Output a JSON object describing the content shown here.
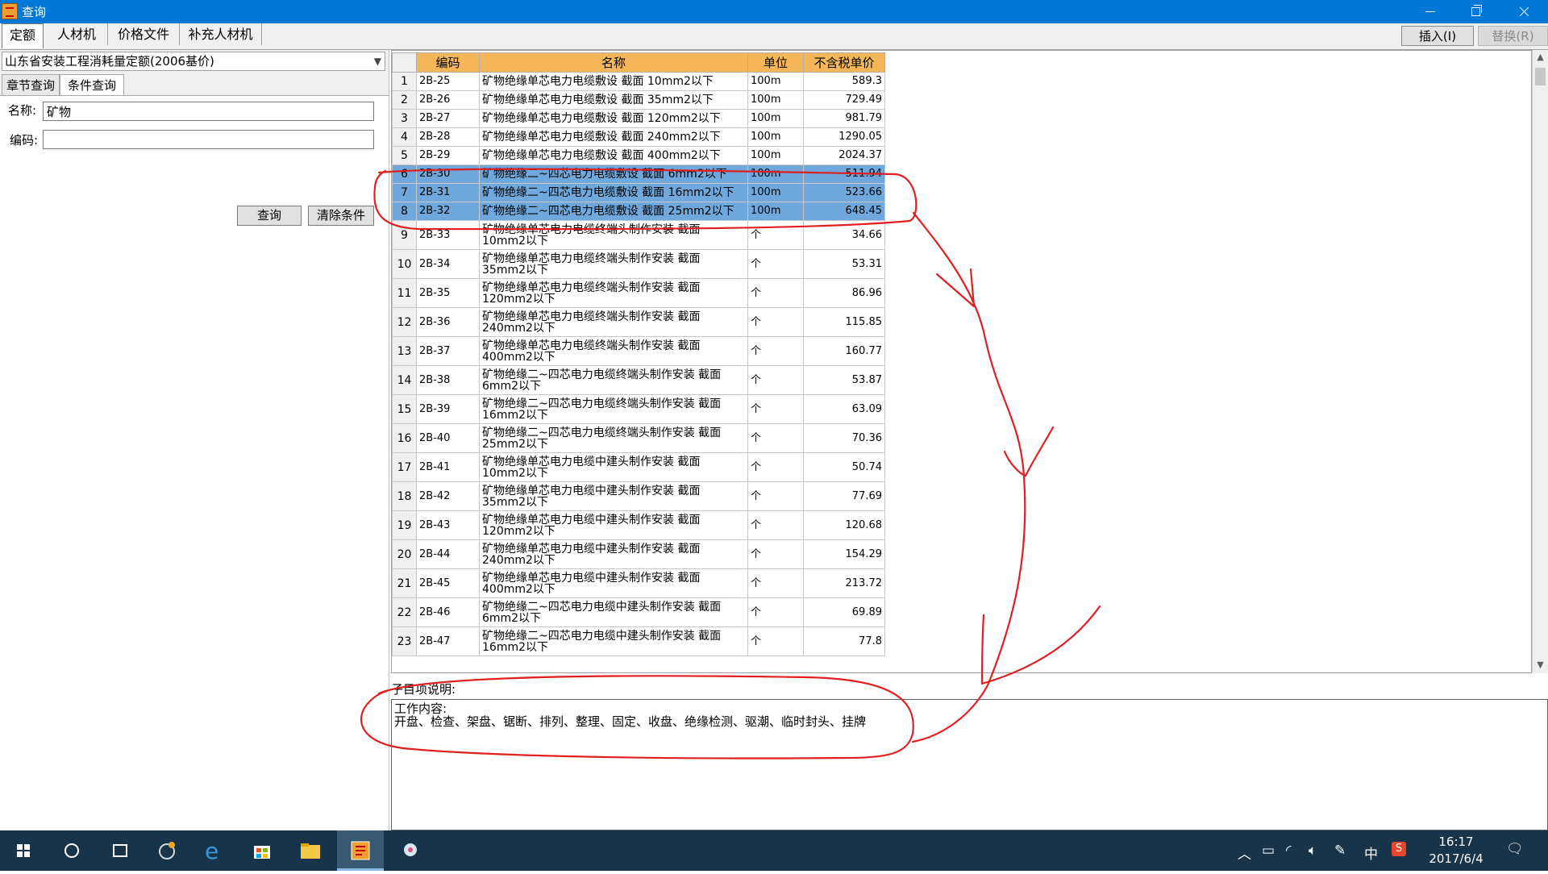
{
  "window": {
    "title": "查询"
  },
  "top_tabs": [
    "定额",
    "人材机",
    "价格文件",
    "补充人材机"
  ],
  "toolbar": {
    "insert_label": "插入(I)",
    "replace_label": "替换(R)"
  },
  "left": {
    "quota_library": "山东省安装工程消耗量定额(2006基价)",
    "sub_tabs": [
      "章节查询",
      "条件查询"
    ],
    "name_label": "名称:",
    "name_value": "矿物",
    "code_label": "编码:",
    "code_value": "",
    "query_button": "查询",
    "clear_button": "清除条件"
  },
  "table": {
    "headers": [
      "编码",
      "名称",
      "单位",
      "不含税单价"
    ],
    "rows": [
      {
        "n": "1",
        "code": "2B-25",
        "name": "矿物绝缘单芯电力电缆敷设 截面 10mm2以下",
        "unit": "100m",
        "price": "589.3"
      },
      {
        "n": "2",
        "code": "2B-26",
        "name": "矿物绝缘单芯电力电缆敷设 截面 35mm2以下",
        "unit": "100m",
        "price": "729.49"
      },
      {
        "n": "3",
        "code": "2B-27",
        "name": "矿物绝缘单芯电力电缆敷设 截面 120mm2以下",
        "unit": "100m",
        "price": "981.79"
      },
      {
        "n": "4",
        "code": "2B-28",
        "name": "矿物绝缘单芯电力电缆敷设 截面 240mm2以下",
        "unit": "100m",
        "price": "1290.05"
      },
      {
        "n": "5",
        "code": "2B-29",
        "name": "矿物绝缘单芯电力电缆敷设 截面 400mm2以下",
        "unit": "100m",
        "price": "2024.37"
      },
      {
        "n": "6",
        "code": "2B-30",
        "name": "矿物绝缘二~四芯电力电缆敷设 截面 6mm2以下",
        "unit": "100m",
        "price": "511.94"
      },
      {
        "n": "7",
        "code": "2B-31",
        "name": "矿物绝缘二~四芯电力电缆敷设 截面 16mm2以下",
        "unit": "100m",
        "price": "523.66"
      },
      {
        "n": "8",
        "code": "2B-32",
        "name": "矿物绝缘二~四芯电力电缆敷设 截面 25mm2以下",
        "unit": "100m",
        "price": "648.45"
      },
      {
        "n": "9",
        "code": "2B-33",
        "name": "矿物绝缘单芯电力电缆终端头制作安装 截面 10mm2以下",
        "unit": "个",
        "price": "34.66"
      },
      {
        "n": "10",
        "code": "2B-34",
        "name": "矿物绝缘单芯电力电缆终端头制作安装 截面 35mm2以下",
        "unit": "个",
        "price": "53.31"
      },
      {
        "n": "11",
        "code": "2B-35",
        "name": "矿物绝缘单芯电力电缆终端头制作安装 截面 120mm2以下",
        "unit": "个",
        "price": "86.96"
      },
      {
        "n": "12",
        "code": "2B-36",
        "name": "矿物绝缘单芯电力电缆终端头制作安装 截面 240mm2以下",
        "unit": "个",
        "price": "115.85"
      },
      {
        "n": "13",
        "code": "2B-37",
        "name": "矿物绝缘单芯电力电缆终端头制作安装 截面 400mm2以下",
        "unit": "个",
        "price": "160.77"
      },
      {
        "n": "14",
        "code": "2B-38",
        "name": "矿物绝缘二~四芯电力电缆终端头制作安装 截面 6mm2以下",
        "unit": "个",
        "price": "53.87"
      },
      {
        "n": "15",
        "code": "2B-39",
        "name": "矿物绝缘二~四芯电力电缆终端头制作安装 截面 16mm2以下",
        "unit": "个",
        "price": "63.09"
      },
      {
        "n": "16",
        "code": "2B-40",
        "name": "矿物绝缘二~四芯电力电缆终端头制作安装 截面 25mm2以下",
        "unit": "个",
        "price": "70.36"
      },
      {
        "n": "17",
        "code": "2B-41",
        "name": "矿物绝缘单芯电力电缆中建头制作安装 截面 10mm2以下",
        "unit": "个",
        "price": "50.74"
      },
      {
        "n": "18",
        "code": "2B-42",
        "name": "矿物绝缘单芯电力电缆中建头制作安装 截面 35mm2以下",
        "unit": "个",
        "price": "77.69"
      },
      {
        "n": "19",
        "code": "2B-43",
        "name": "矿物绝缘单芯电力电缆中建头制作安装 截面 120mm2以下",
        "unit": "个",
        "price": "120.68"
      },
      {
        "n": "20",
        "code": "2B-44",
        "name": "矿物绝缘单芯电力电缆中建头制作安装 截面 240mm2以下",
        "unit": "个",
        "price": "154.29"
      },
      {
        "n": "21",
        "code": "2B-45",
        "name": "矿物绝缘单芯电力电缆中建头制作安装 截面 400mm2以下",
        "unit": "个",
        "price": "213.72"
      },
      {
        "n": "22",
        "code": "2B-46",
        "name": "矿物绝缘二~四芯电力电缆中建头制作安装 截面 6mm2以下",
        "unit": "个",
        "price": "69.89"
      },
      {
        "n": "23",
        "code": "2B-47",
        "name": "矿物绝缘二~四芯电力电缆中建头制作安装 截面 16mm2以下",
        "unit": "个",
        "price": "77.8"
      }
    ],
    "selected_rows": [
      "6",
      "7",
      "8"
    ]
  },
  "description": {
    "label": "子目项说明:",
    "heading": "工作内容:",
    "content": "开盘、检查、架盘、锯断、排列、整理、固定、收盘、绝缘检测、驱潮、临时封头、挂牌"
  },
  "annotation_color": "#e02020",
  "selection_color": "#6fa8dc",
  "taskbar": {
    "time": "16:17",
    "date": "2017/6/4",
    "ime": "中"
  }
}
